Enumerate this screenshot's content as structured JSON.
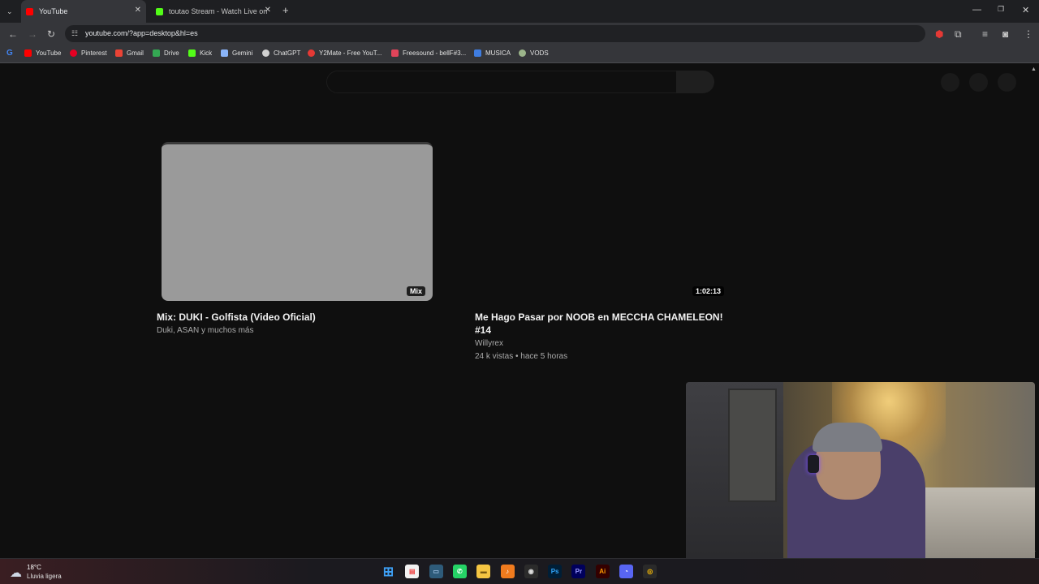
{
  "tabs": [
    {
      "title": "YouTube",
      "active": true,
      "favicon_color": "#ff0000"
    },
    {
      "title": "toutao Stream - Watch Live on",
      "active": false,
      "favicon_color": "#53fc18"
    }
  ],
  "window_controls": {
    "minimize": "—",
    "restore": "❐",
    "close": "✕"
  },
  "address_bar": {
    "url": "youtube.com/?app=desktop&hl=es"
  },
  "bookmarks": [
    {
      "label": "YouTube",
      "color": "#ff0000"
    },
    {
      "label": "Pinterest",
      "color": "#e60023"
    },
    {
      "label": "Gmail",
      "color": "#ea4335"
    },
    {
      "label": "Drive",
      "color": "#34a853"
    },
    {
      "label": "Kick",
      "color": "#53fc18"
    },
    {
      "label": "Gemini",
      "color": "#8ab4f8"
    },
    {
      "label": "ChatGPT",
      "color": "#d0d0d0"
    },
    {
      "label": "Y2Mate - Free YouT...",
      "color": "#e53935"
    },
    {
      "label": "Freesound - bellF#3...",
      "color": "#e0445a"
    },
    {
      "label": "MUSICA",
      "color": "#3f7de0"
    },
    {
      "label": "VODS",
      "color": "#9bb48a"
    }
  ],
  "videos": [
    {
      "title": "Mix: DUKI - Golfista (Video Oficial)",
      "channel": "Duki, ASAN y muchos más",
      "badge": "Mix"
    },
    {
      "title_line1": "Me Hago Pasar por NOOB en MECCHA CHAMELEON!",
      "title_line2": "#14",
      "channel": "Willyrex",
      "meta": "24 k vistas • hace 5 horas",
      "badge": "1:02:13"
    }
  ],
  "taskbar": {
    "weather_temp": "18°C",
    "weather_desc": "Lluvia ligera",
    "apps": [
      {
        "name": "start",
        "glyph": "⊞",
        "color": "#3ea0f5",
        "bg": "transparent"
      },
      {
        "name": "notepad",
        "glyph": "▤",
        "color": "#e44",
        "bg": "#f2f2f2"
      },
      {
        "name": "task-view",
        "glyph": "▭",
        "color": "#9bd",
        "bg": "#2e5b7a"
      },
      {
        "name": "whatsapp",
        "glyph": "✆",
        "color": "#fff",
        "bg": "#25d366"
      },
      {
        "name": "file-explorer",
        "glyph": "▬",
        "color": "#7a5a10",
        "bg": "#f5c542"
      },
      {
        "name": "fl-studio",
        "glyph": "♪",
        "color": "#fff",
        "bg": "#f07b1e"
      },
      {
        "name": "obs",
        "glyph": "◉",
        "color": "#ddd",
        "bg": "#2b2b2b"
      },
      {
        "name": "photoshop",
        "glyph": "Ps",
        "color": "#31a8ff",
        "bg": "#001e36"
      },
      {
        "name": "premiere",
        "glyph": "Pr",
        "color": "#9999ff",
        "bg": "#00005b"
      },
      {
        "name": "illustrator",
        "glyph": "Ai",
        "color": "#ff9a00",
        "bg": "#330000"
      },
      {
        "name": "discord",
        "glyph": "◔",
        "color": "#fff",
        "bg": "#5865f2"
      },
      {
        "name": "chrome",
        "glyph": "◎",
        "color": "#fbbc05",
        "bg": "#2a2a2a"
      }
    ]
  }
}
